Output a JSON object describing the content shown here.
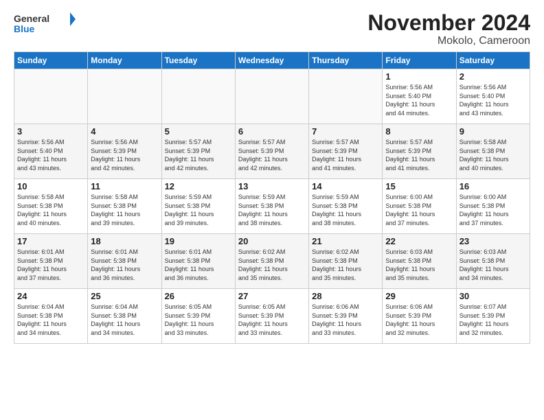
{
  "logo": {
    "general": "General",
    "blue": "Blue"
  },
  "header": {
    "month": "November 2024",
    "location": "Mokolo, Cameroon"
  },
  "days_of_week": [
    "Sunday",
    "Monday",
    "Tuesday",
    "Wednesday",
    "Thursday",
    "Friday",
    "Saturday"
  ],
  "weeks": [
    [
      {
        "day": "",
        "info": ""
      },
      {
        "day": "",
        "info": ""
      },
      {
        "day": "",
        "info": ""
      },
      {
        "day": "",
        "info": ""
      },
      {
        "day": "",
        "info": ""
      },
      {
        "day": "1",
        "info": "Sunrise: 5:56 AM\nSunset: 5:40 PM\nDaylight: 11 hours\nand 44 minutes."
      },
      {
        "day": "2",
        "info": "Sunrise: 5:56 AM\nSunset: 5:40 PM\nDaylight: 11 hours\nand 43 minutes."
      }
    ],
    [
      {
        "day": "3",
        "info": "Sunrise: 5:56 AM\nSunset: 5:40 PM\nDaylight: 11 hours\nand 43 minutes."
      },
      {
        "day": "4",
        "info": "Sunrise: 5:56 AM\nSunset: 5:39 PM\nDaylight: 11 hours\nand 42 minutes."
      },
      {
        "day": "5",
        "info": "Sunrise: 5:57 AM\nSunset: 5:39 PM\nDaylight: 11 hours\nand 42 minutes."
      },
      {
        "day": "6",
        "info": "Sunrise: 5:57 AM\nSunset: 5:39 PM\nDaylight: 11 hours\nand 42 minutes."
      },
      {
        "day": "7",
        "info": "Sunrise: 5:57 AM\nSunset: 5:39 PM\nDaylight: 11 hours\nand 41 minutes."
      },
      {
        "day": "8",
        "info": "Sunrise: 5:57 AM\nSunset: 5:39 PM\nDaylight: 11 hours\nand 41 minutes."
      },
      {
        "day": "9",
        "info": "Sunrise: 5:58 AM\nSunset: 5:38 PM\nDaylight: 11 hours\nand 40 minutes."
      }
    ],
    [
      {
        "day": "10",
        "info": "Sunrise: 5:58 AM\nSunset: 5:38 PM\nDaylight: 11 hours\nand 40 minutes."
      },
      {
        "day": "11",
        "info": "Sunrise: 5:58 AM\nSunset: 5:38 PM\nDaylight: 11 hours\nand 39 minutes."
      },
      {
        "day": "12",
        "info": "Sunrise: 5:59 AM\nSunset: 5:38 PM\nDaylight: 11 hours\nand 39 minutes."
      },
      {
        "day": "13",
        "info": "Sunrise: 5:59 AM\nSunset: 5:38 PM\nDaylight: 11 hours\nand 38 minutes."
      },
      {
        "day": "14",
        "info": "Sunrise: 5:59 AM\nSunset: 5:38 PM\nDaylight: 11 hours\nand 38 minutes."
      },
      {
        "day": "15",
        "info": "Sunrise: 6:00 AM\nSunset: 5:38 PM\nDaylight: 11 hours\nand 37 minutes."
      },
      {
        "day": "16",
        "info": "Sunrise: 6:00 AM\nSunset: 5:38 PM\nDaylight: 11 hours\nand 37 minutes."
      }
    ],
    [
      {
        "day": "17",
        "info": "Sunrise: 6:01 AM\nSunset: 5:38 PM\nDaylight: 11 hours\nand 37 minutes."
      },
      {
        "day": "18",
        "info": "Sunrise: 6:01 AM\nSunset: 5:38 PM\nDaylight: 11 hours\nand 36 minutes."
      },
      {
        "day": "19",
        "info": "Sunrise: 6:01 AM\nSunset: 5:38 PM\nDaylight: 11 hours\nand 36 minutes."
      },
      {
        "day": "20",
        "info": "Sunrise: 6:02 AM\nSunset: 5:38 PM\nDaylight: 11 hours\nand 35 minutes."
      },
      {
        "day": "21",
        "info": "Sunrise: 6:02 AM\nSunset: 5:38 PM\nDaylight: 11 hours\nand 35 minutes."
      },
      {
        "day": "22",
        "info": "Sunrise: 6:03 AM\nSunset: 5:38 PM\nDaylight: 11 hours\nand 35 minutes."
      },
      {
        "day": "23",
        "info": "Sunrise: 6:03 AM\nSunset: 5:38 PM\nDaylight: 11 hours\nand 34 minutes."
      }
    ],
    [
      {
        "day": "24",
        "info": "Sunrise: 6:04 AM\nSunset: 5:38 PM\nDaylight: 11 hours\nand 34 minutes."
      },
      {
        "day": "25",
        "info": "Sunrise: 6:04 AM\nSunset: 5:38 PM\nDaylight: 11 hours\nand 34 minutes."
      },
      {
        "day": "26",
        "info": "Sunrise: 6:05 AM\nSunset: 5:39 PM\nDaylight: 11 hours\nand 33 minutes."
      },
      {
        "day": "27",
        "info": "Sunrise: 6:05 AM\nSunset: 5:39 PM\nDaylight: 11 hours\nand 33 minutes."
      },
      {
        "day": "28",
        "info": "Sunrise: 6:06 AM\nSunset: 5:39 PM\nDaylight: 11 hours\nand 33 minutes."
      },
      {
        "day": "29",
        "info": "Sunrise: 6:06 AM\nSunset: 5:39 PM\nDaylight: 11 hours\nand 32 minutes."
      },
      {
        "day": "30",
        "info": "Sunrise: 6:07 AM\nSunset: 5:39 PM\nDaylight: 11 hours\nand 32 minutes."
      }
    ]
  ]
}
